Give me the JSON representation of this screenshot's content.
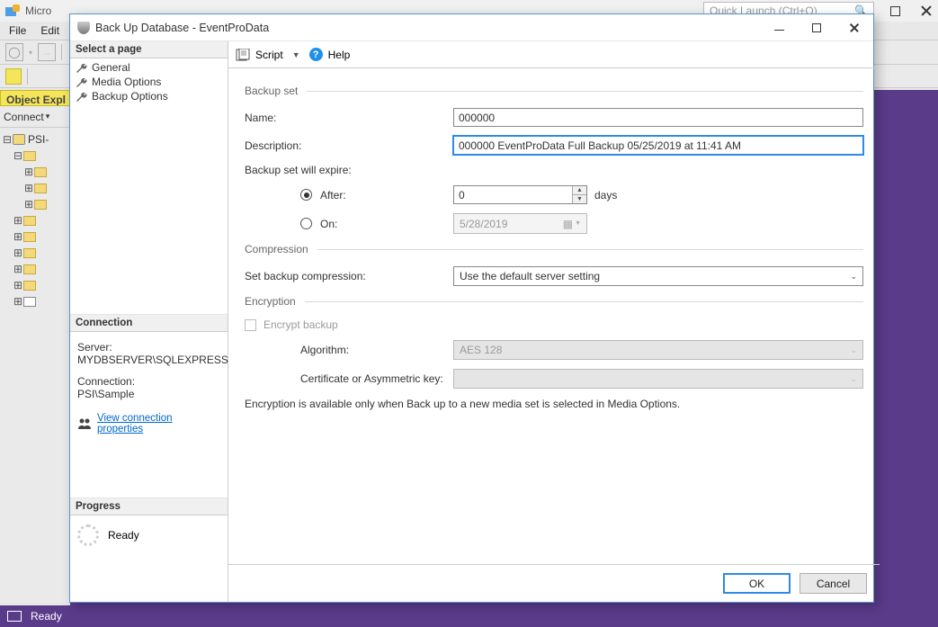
{
  "bg": {
    "title": "Micro",
    "menu": {
      "file": "File",
      "edit": "Edit"
    },
    "quick_launch_placeholder": "Quick Launch (Ctrl+Q)",
    "object_explorer": "Object Expl",
    "connect": "Connect",
    "tree_root": "PSI-",
    "status": "Ready"
  },
  "dialog": {
    "title": "Back Up Database - EventProData",
    "pages_header": "Select a page",
    "pages": {
      "general": "General",
      "media": "Media Options",
      "backup": "Backup Options"
    },
    "toolbar": {
      "script": "Script",
      "help": "Help"
    },
    "sections": {
      "backup_set": "Backup set",
      "compression": "Compression",
      "encryption": "Encryption"
    },
    "labels": {
      "name": "Name:",
      "description": "Description:",
      "expire": "Backup set will expire:",
      "after": "After:",
      "on": "On:",
      "days": "days",
      "compression": "Set backup compression:",
      "encrypt": "Encrypt backup",
      "algorithm": "Algorithm:",
      "cert": "Certificate or Asymmetric key:"
    },
    "values": {
      "name": "000000",
      "description": "000000 EventProData Full Backup 05/25/2019 at 11:41 AM",
      "after_days": "0",
      "on_date": "5/28/2019",
      "compression": "Use the default server setting",
      "algorithm": "AES 128",
      "cert": ""
    },
    "encryption_note": "Encryption is available only when Back up to a new media set is selected in Media Options.",
    "connection": {
      "header": "Connection",
      "server_label": "Server:",
      "server": "MYDBSERVER\\SQLEXPRESS",
      "conn_label": "Connection:",
      "conn": "PSI\\Sample",
      "view_props": "View connection properties"
    },
    "progress": {
      "header": "Progress",
      "status": "Ready"
    },
    "buttons": {
      "ok": "OK",
      "cancel": "Cancel"
    }
  }
}
